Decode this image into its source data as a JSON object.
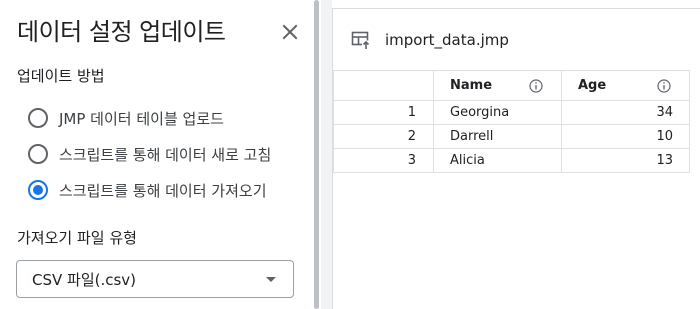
{
  "panel": {
    "title": "데이터 설정 업데이트",
    "close_icon": "close-icon",
    "update_method": {
      "label": "업데이트 방법",
      "options": [
        {
          "label": "JMP 데이터 테이블 업로드",
          "checked": false
        },
        {
          "label": "스크립트를 통해 데이터 새로 고침",
          "checked": false
        },
        {
          "label": "스크립트를 통해 데이터 가져오기",
          "checked": true
        }
      ]
    },
    "file_type": {
      "label": "가져오기 파일 유형",
      "selected": "CSV 파일(.csv)"
    }
  },
  "preview": {
    "file_icon": "table-import-icon",
    "file_name": "import_data.jmp",
    "columns": [
      "",
      "Name",
      "Age"
    ],
    "rows": [
      {
        "index": "1",
        "name": "Georgina",
        "age": "34"
      },
      {
        "index": "2",
        "name": "Darrell",
        "age": "10"
      },
      {
        "index": "3",
        "name": "Alicia",
        "age": "13"
      }
    ]
  },
  "colors": {
    "accent": "#1a73e8",
    "radio_border": "#5f6368",
    "grid_border": "#e0e0e0",
    "gutter": "#f1f3f4"
  }
}
